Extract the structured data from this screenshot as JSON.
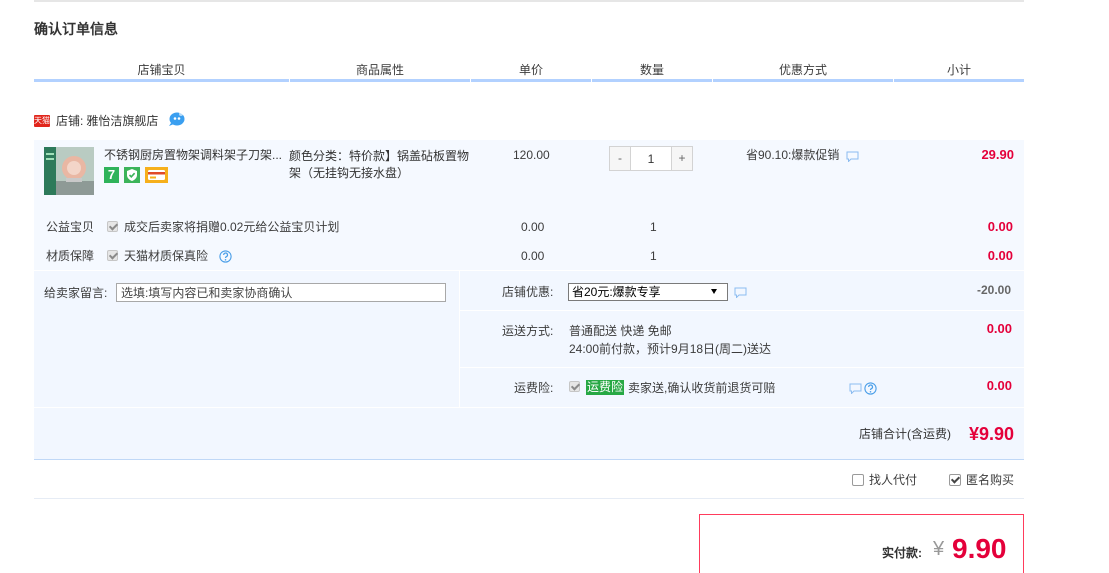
{
  "colors": {
    "accent_red": "#e4003a",
    "header_line": "#b2d1ff",
    "panel_bg": "#f2f7ff",
    "item_bg": "#f5f9ff",
    "tmall_red": "#e1251b",
    "service_green": "#2fb35a",
    "paybox_border": "#ff3b5c"
  },
  "page": {
    "title": "确认订单信息"
  },
  "table_header": {
    "shop_item": "店铺宝贝",
    "attributes": "商品属性",
    "unit_price": "单价",
    "quantity": "数量",
    "discount": "优惠方式",
    "subtotal": "小计"
  },
  "shop": {
    "badge": "天猫",
    "label": "店铺:",
    "name": "雅怡洁旗舰店",
    "contact_icon": "wangwang-chat-icon"
  },
  "item": {
    "thumbnail_icon": "kitchen-rack-product-image",
    "title": "不锈钢厨房置物架调料架子刀架...",
    "service_badges": [
      {
        "icon": "seven-day-return-icon",
        "text": "7"
      },
      {
        "icon": "guarantee-shield-icon"
      },
      {
        "icon": "credit-card-icon"
      }
    ],
    "attributes": [
      "颜色分类：特价款】锅盖砧板置物",
      "架（无挂钩无接水盘）"
    ],
    "unit_price": "120.00",
    "quantity": {
      "minus": "-",
      "value": "1",
      "plus": "+"
    },
    "promotion": "省90.10:爆款促销",
    "subtotal": "29.90"
  },
  "services": [
    {
      "label": "公益宝贝",
      "checked": true,
      "text": "成交后卖家将捐赠0.02元给公益宝贝计划",
      "unit_price": "0.00",
      "quantity": "1",
      "subtotal": "0.00"
    },
    {
      "label": "材质保障",
      "checked": true,
      "text": "天猫材质保真险",
      "unit_price": "0.00",
      "quantity": "1",
      "subtotal": "0.00"
    }
  ],
  "message": {
    "label": "给卖家留言:",
    "placeholder": "选填:填写内容已和卖家协商确认"
  },
  "shop_discount": {
    "label": "店铺优惠:",
    "selected": "省20元:爆款专享",
    "amount": "-20.00"
  },
  "shipping": {
    "label": "运送方式:",
    "method": "普通配送 快递 免邮",
    "eta": "24:00前付款，预计9月18日(周二)送达",
    "amount": "0.00"
  },
  "freight_insurance": {
    "label": "运费险:",
    "checked": true,
    "badge": "运费险",
    "text": "卖家送,确认收货前退货可赔",
    "amount": "0.00"
  },
  "shop_total": {
    "label": "店铺合计(含运费)",
    "amount": "¥9.90"
  },
  "options": [
    {
      "label": "找人代付",
      "checked": false
    },
    {
      "label": "匿名购买",
      "checked": true
    }
  ],
  "payment": {
    "label": "实付款:",
    "currency": "¥",
    "amount": "9.90"
  }
}
